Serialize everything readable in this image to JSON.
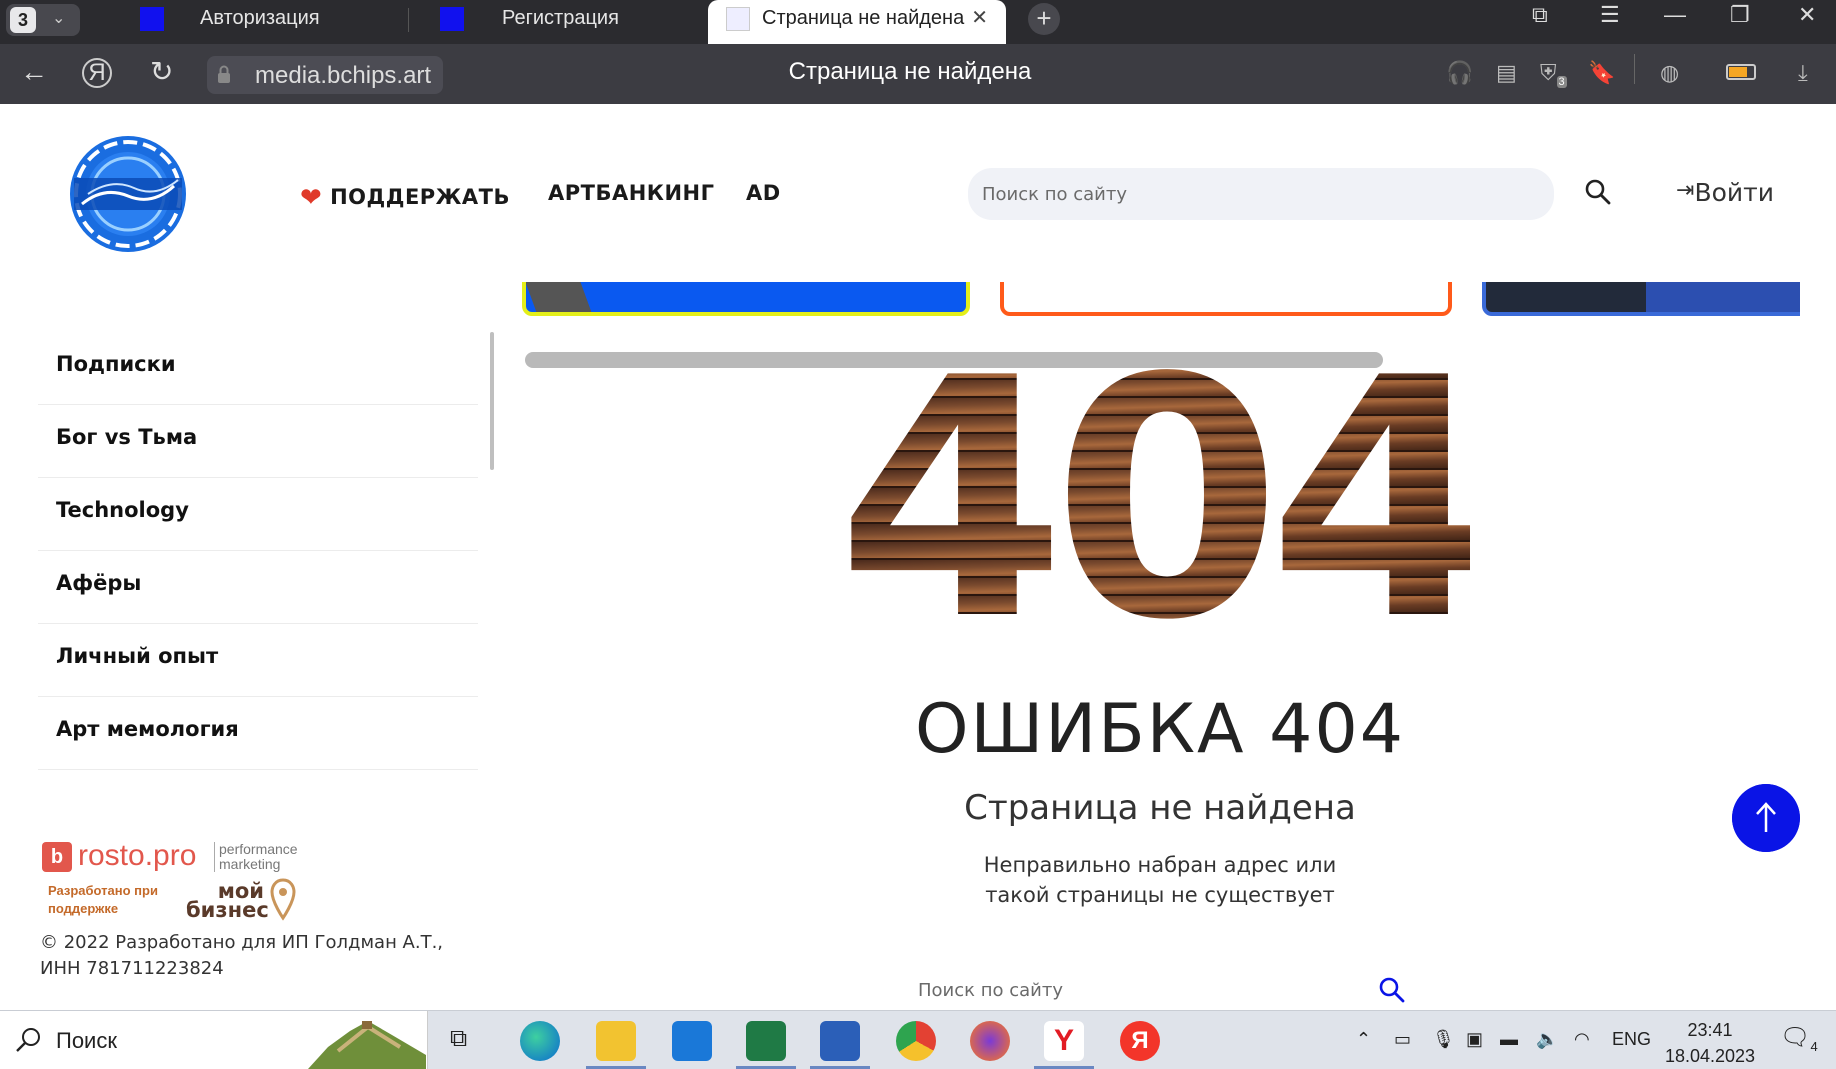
{
  "browser": {
    "tab_count": "3",
    "tabs": [
      {
        "title": "Авторизация"
      },
      {
        "title": "Регистрация"
      },
      {
        "title": "Страница не найдена"
      }
    ],
    "url": "media.bchips.art",
    "page_title": "Страница не найдена",
    "shield_badge": "3"
  },
  "header": {
    "nav": [
      {
        "label": "ПОДДЕРЖАТЬ"
      },
      {
        "label": "АРТБАНКИНГ"
      },
      {
        "label": "AD"
      }
    ],
    "search_placeholder": "Поиск по сайту",
    "login_label": "Войти"
  },
  "sidebar": {
    "items": [
      {
        "label": "Подписки"
      },
      {
        "label": "Бог vs Тьма"
      },
      {
        "label": "Technology"
      },
      {
        "label": "Афёры"
      },
      {
        "label": "Личный опыт"
      },
      {
        "label": "Арт мемология"
      }
    ]
  },
  "footer": {
    "partner1_name": "rosto.pro",
    "partner1_tagline": "performance marketing",
    "partner2_text": "Разработано при поддержке",
    "partner3_name": "мой бизнес",
    "copyright": "© 2022 Разработано для ИП Голдман А.Т., ИНН 781711223824"
  },
  "error": {
    "big_code": "404",
    "title": "ОШИБКА 404",
    "subtitle": "Страница не найдена",
    "description_line1": "Неправильно набран адрес или",
    "description_line2": "такой страницы не существует",
    "search_placeholder": "Поиск по сайту"
  },
  "taskbar": {
    "search_label": "Поиск",
    "language": "ENG",
    "time": "23:41",
    "date": "18.04.2023",
    "notifications": "4"
  },
  "colors": {
    "accent_blue": "#0a14e6",
    "card1_border": "#e4ef1a",
    "card2_border": "#ff5a1a",
    "card3_border": "#3a6ad8"
  }
}
